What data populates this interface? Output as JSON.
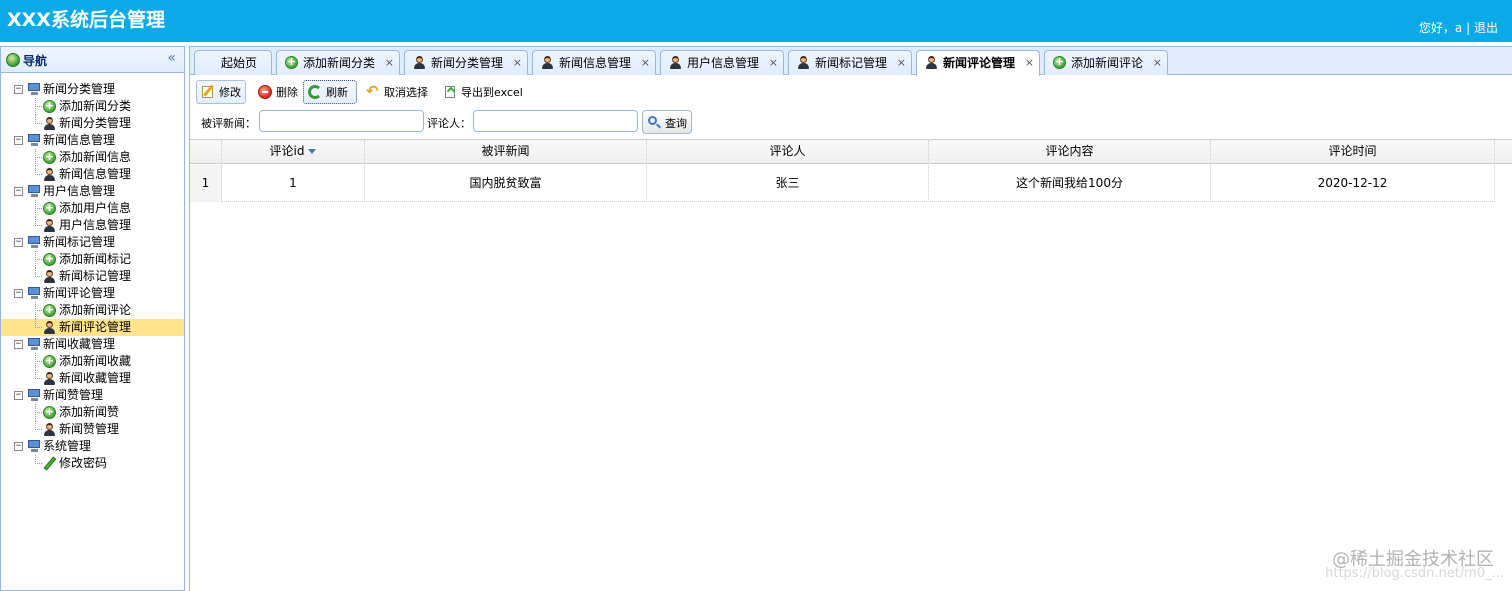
{
  "header": {
    "title": "XXX系统后台管理",
    "greeting": "您好，a",
    "separator": "|",
    "logout": "退出"
  },
  "nav": {
    "title": "导航",
    "collapse_glyph": "«",
    "groups": [
      {
        "label": "新闻分类管理",
        "children": [
          {
            "icon": "add-icon",
            "label": "添加新闻分类"
          },
          {
            "icon": "user-icon",
            "label": "新闻分类管理"
          }
        ]
      },
      {
        "label": "新闻信息管理",
        "children": [
          {
            "icon": "add-icon",
            "label": "添加新闻信息"
          },
          {
            "icon": "user-icon",
            "label": "新闻信息管理"
          }
        ]
      },
      {
        "label": "用户信息管理",
        "children": [
          {
            "icon": "add-icon",
            "label": "添加用户信息"
          },
          {
            "icon": "user-icon",
            "label": "用户信息管理"
          }
        ]
      },
      {
        "label": "新闻标记管理",
        "children": [
          {
            "icon": "add-icon",
            "label": "添加新闻标记"
          },
          {
            "icon": "user-icon",
            "label": "新闻标记管理"
          }
        ]
      },
      {
        "label": "新闻评论管理",
        "children": [
          {
            "icon": "add-icon",
            "label": "添加新闻评论"
          },
          {
            "icon": "user-icon",
            "label": "新闻评论管理",
            "selected": true
          }
        ]
      },
      {
        "label": "新闻收藏管理",
        "children": [
          {
            "icon": "add-icon",
            "label": "添加新闻收藏"
          },
          {
            "icon": "user-icon",
            "label": "新闻收藏管理"
          }
        ]
      },
      {
        "label": "新闻赞管理",
        "children": [
          {
            "icon": "add-icon",
            "label": "添加新闻赞"
          },
          {
            "icon": "user-icon",
            "label": "新闻赞管理"
          }
        ]
      },
      {
        "label": "系统管理",
        "children": [
          {
            "icon": "pencil-icon",
            "label": "修改密码"
          }
        ]
      }
    ]
  },
  "tabs": [
    {
      "label": "起始页",
      "icon": "none",
      "closable": false
    },
    {
      "label": "添加新闻分类",
      "icon": "add-icon",
      "closable": true
    },
    {
      "label": "新闻分类管理",
      "icon": "user-icon",
      "closable": true
    },
    {
      "label": "新闻信息管理",
      "icon": "user-icon",
      "closable": true
    },
    {
      "label": "用户信息管理",
      "icon": "user-icon",
      "closable": true
    },
    {
      "label": "新闻标记管理",
      "icon": "user-icon",
      "closable": true
    },
    {
      "label": "新闻评论管理",
      "icon": "user-icon",
      "closable": true,
      "active": true
    },
    {
      "label": "添加新闻评论",
      "icon": "add-icon",
      "closable": true
    }
  ],
  "tab_close_glyph": "×",
  "toolbar": {
    "edit": "修改",
    "delete": "删除",
    "refresh": "刷新",
    "unselect": "取消选择",
    "export": "导出到excel"
  },
  "search": {
    "news_label": "被评新闻：",
    "news_value": "",
    "commenter_label": "评论人：",
    "commenter_value": "",
    "button": "查询"
  },
  "grid": {
    "columns": [
      "评论id",
      "被评新闻",
      "评论人",
      "评论内容",
      "评论时间"
    ],
    "rows": [
      {
        "num": "1",
        "cells": [
          "1",
          "国内脱贫致富",
          "张三",
          "这个新闻我给100分",
          "2020-12-12"
        ]
      }
    ]
  },
  "watermark": "@稀土掘金技术社区",
  "watermark_url": "https://blog.csdn.net/m0_..."
}
